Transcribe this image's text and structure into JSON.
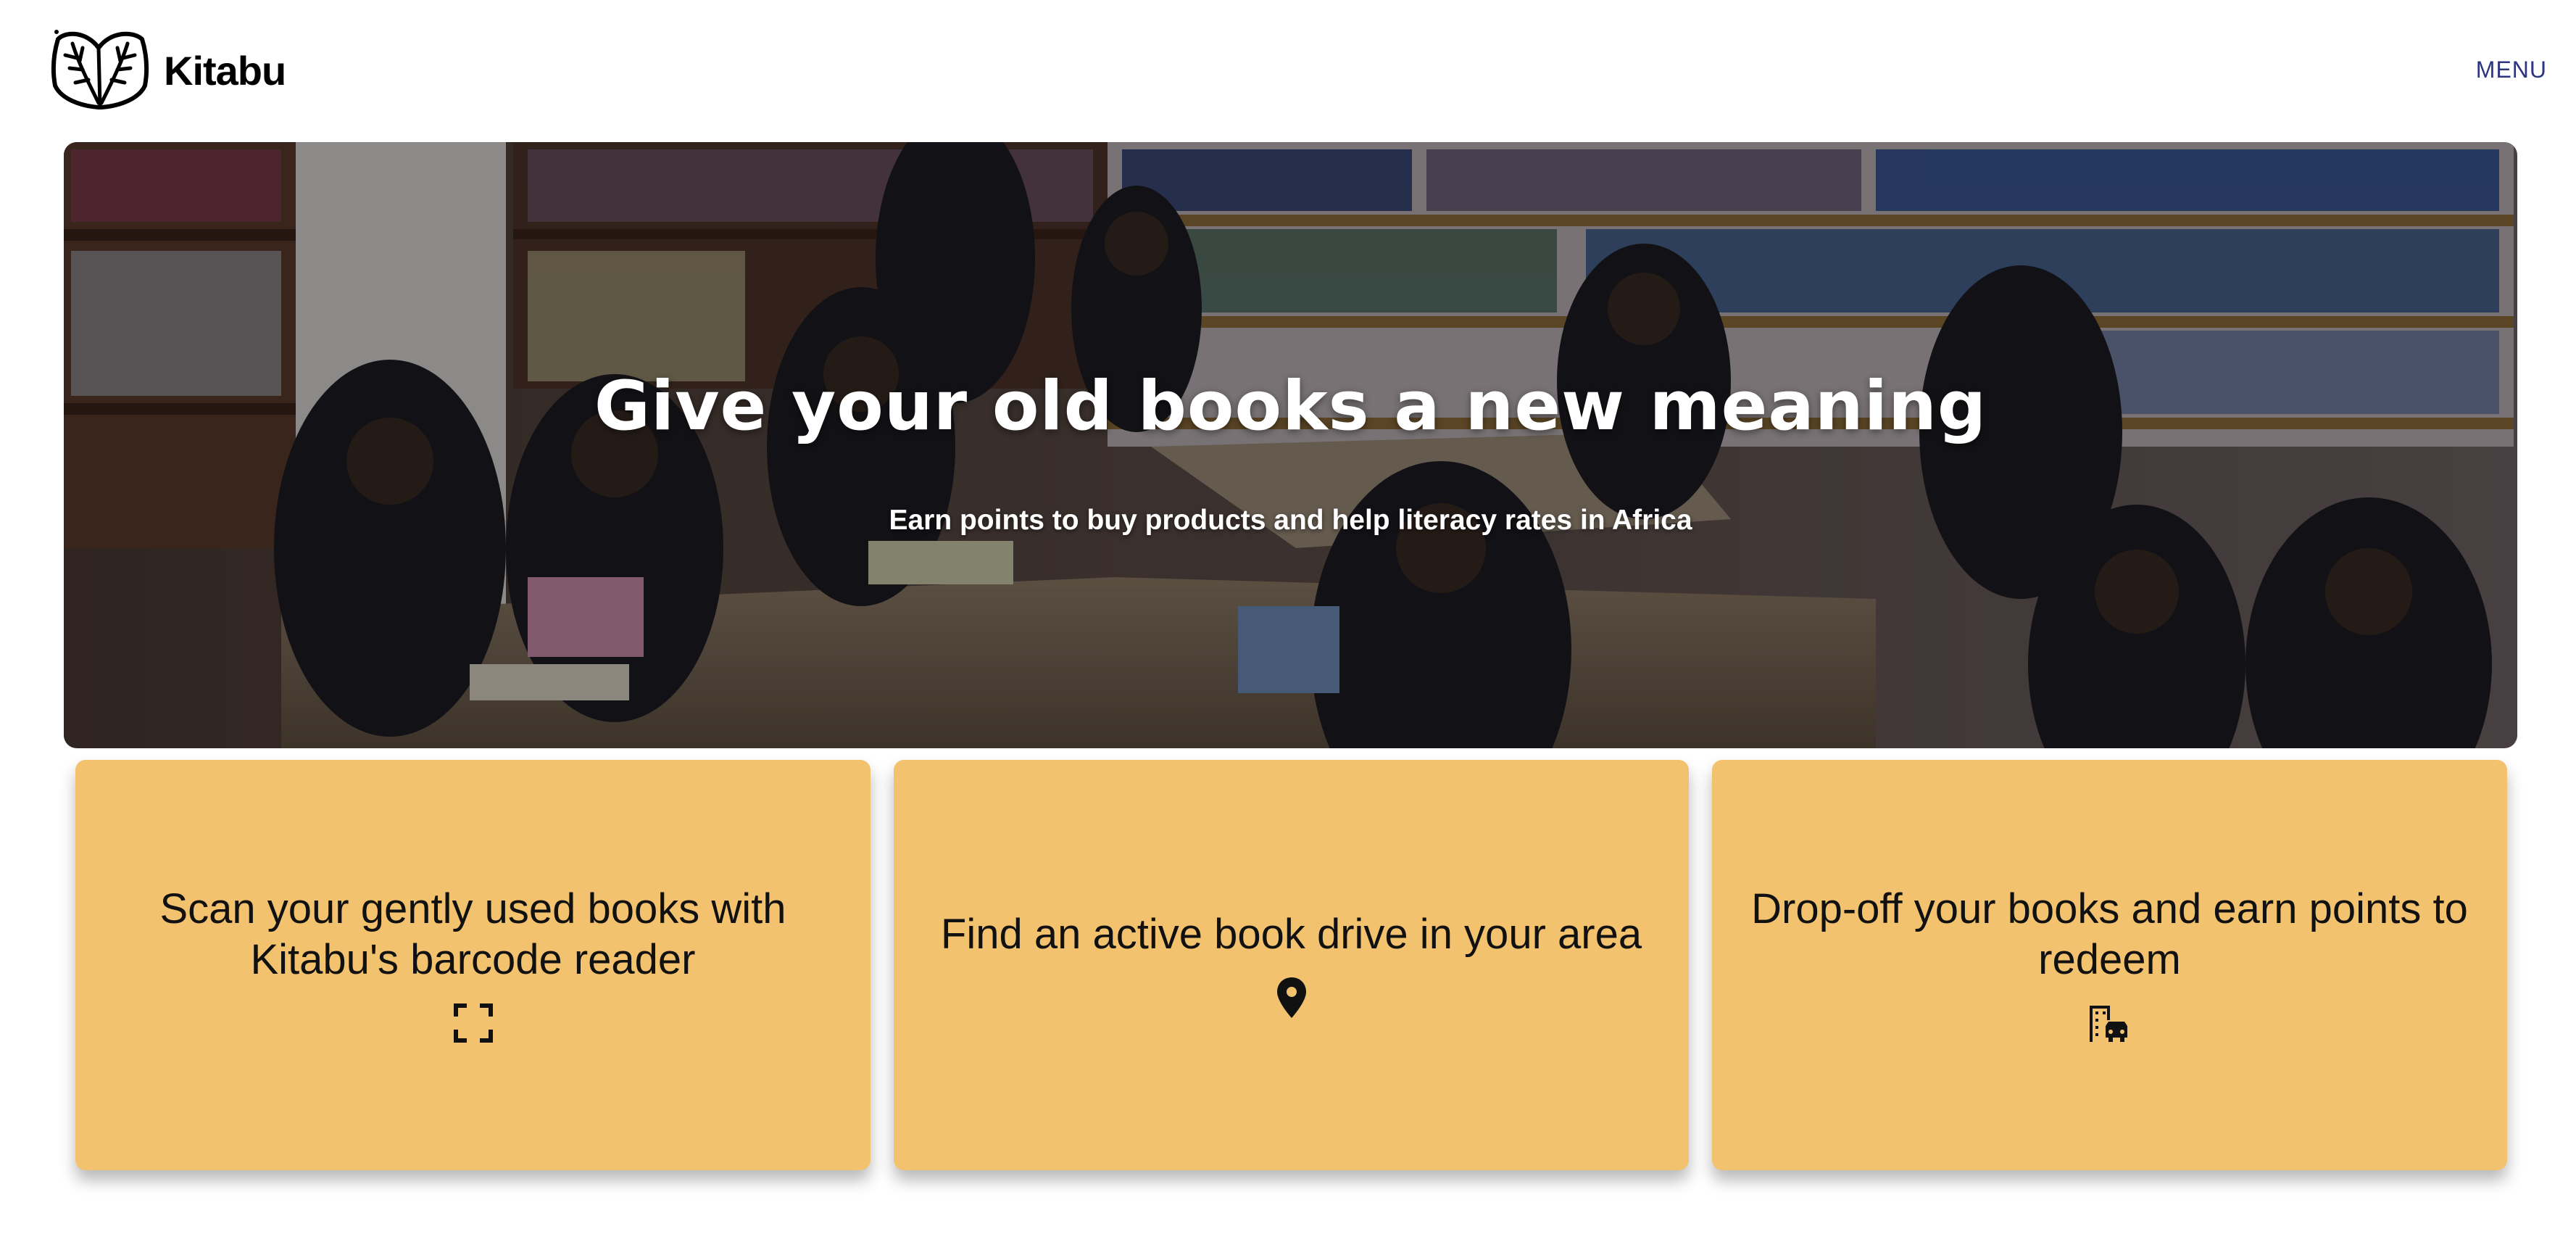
{
  "header": {
    "brand": "Kitabu",
    "menu_label": "MENU",
    "logo_icon": "leaf-book-icon"
  },
  "hero": {
    "title": "Give your old books a new meaning",
    "subtitle": "Earn points to buy products and help literacy rates in Africa"
  },
  "cards": [
    {
      "text": "Scan your gently used books with Kitabu's barcode reader",
      "icon": "scan-frame-icon"
    },
    {
      "text": "Find an active book drive in your area",
      "icon": "location-pin-icon"
    },
    {
      "text": "Drop-off your books and earn points to redeem",
      "icon": "building-car-icon"
    }
  ],
  "colors": {
    "card_background": "#f3c26e",
    "menu_text": "#2c3580",
    "hero_text": "#ffffff"
  }
}
